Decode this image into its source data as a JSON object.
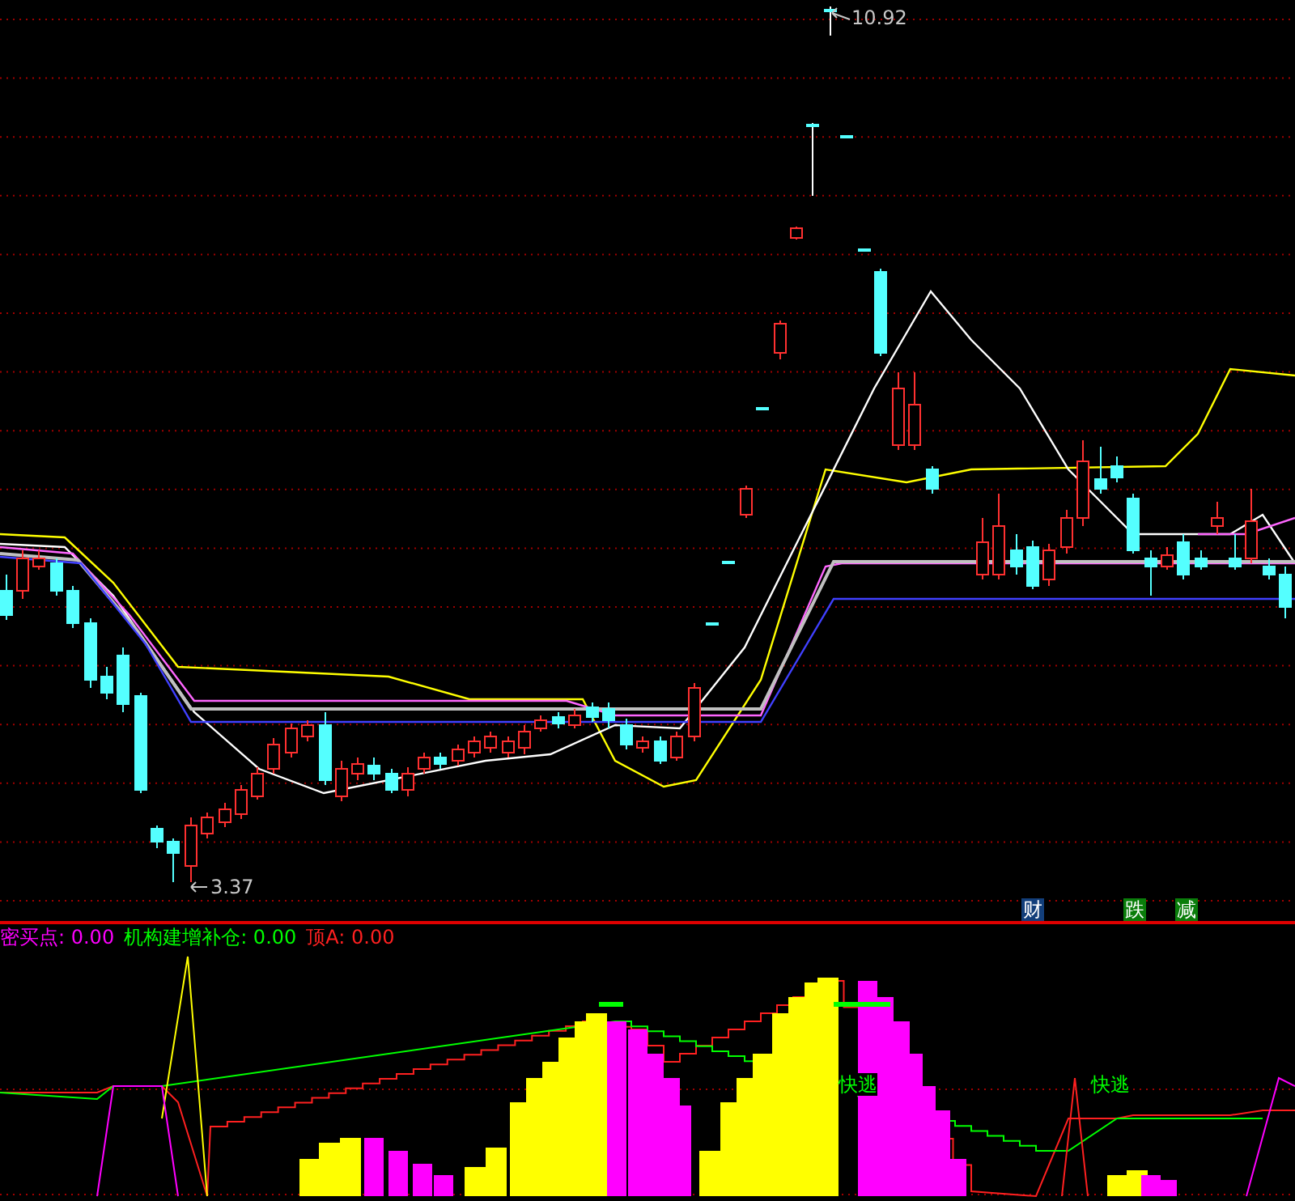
{
  "price_chart": {
    "high_label": "10.92",
    "low_label": "3.37",
    "signals": [
      {
        "text": "财",
        "color": "#123e7a"
      },
      {
        "text": "跌",
        "color": "#0a7d0a"
      },
      {
        "text": "减",
        "color": "#0a7d0a"
      }
    ]
  },
  "indicator": {
    "legend": [
      {
        "text": "密买点: 0.00",
        "color": "#ff00ff"
      },
      {
        "text": "机构建增补仓: 0.00",
        "color": "#00ff00"
      },
      {
        "text": "顶A: 0.00",
        "color": "#ff2020"
      }
    ],
    "labels": [
      "快逃",
      "快逃"
    ]
  }
}
